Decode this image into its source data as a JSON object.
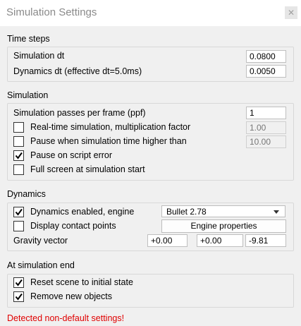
{
  "window": {
    "title": "Simulation Settings",
    "close_glyph": "✕"
  },
  "time_steps": {
    "title": "Time steps",
    "sim_dt_label": "Simulation dt",
    "sim_dt_value": "0.0800",
    "dyn_dt_label": "Dynamics dt (effective dt=5.0ms)",
    "dyn_dt_value": "0.0050"
  },
  "simulation": {
    "title": "Simulation",
    "passes_label": "Simulation passes per frame (ppf)",
    "passes_value": "1",
    "realtime_label": "Real-time simulation, multiplication factor",
    "realtime_checked": false,
    "realtime_value": "1.00",
    "pause_time_label": "Pause when simulation time higher than",
    "pause_time_checked": false,
    "pause_time_value": "10.00",
    "pause_error_label": "Pause on script error",
    "pause_error_checked": true,
    "fullscreen_label": "Full screen at simulation start",
    "fullscreen_checked": false
  },
  "dynamics": {
    "title": "Dynamics",
    "enabled_label": "Dynamics enabled, engine",
    "enabled_checked": true,
    "engine_selected": "Bullet 2.78",
    "contact_label": "Display contact points",
    "contact_checked": false,
    "engine_props_label": "Engine properties",
    "gravity_label": "Gravity vector",
    "gravity_x": "+0.00",
    "gravity_y": "+0.00",
    "gravity_z": "-9.81"
  },
  "at_end": {
    "title": "At simulation end",
    "reset_label": "Reset scene to initial state",
    "reset_checked": true,
    "remove_label": "Remove new objects",
    "remove_checked": true
  },
  "warning_text": "Detected non-default settings!",
  "colors": {
    "warning": "#e00000",
    "title_text": "#8a8a8a"
  }
}
